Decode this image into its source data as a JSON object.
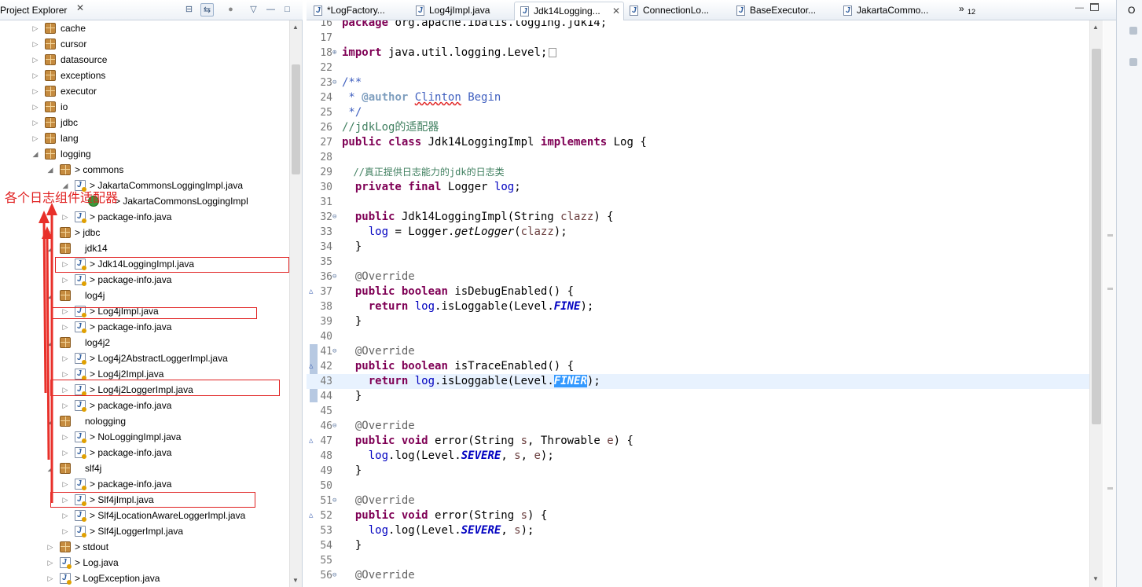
{
  "explorer": {
    "title": "Project Explorer",
    "close": "✕",
    "buttons": {
      "collapse": "⊟",
      "link": "⇆",
      "focus": "●",
      "menu": "▽",
      "minimize": "—",
      "maximize": "□"
    },
    "tree": [
      {
        "label": "cache",
        "kind": "pkg",
        "twisty": "▷"
      },
      {
        "label": "cursor",
        "kind": "pkg",
        "twisty": "▷"
      },
      {
        "label": "datasource",
        "kind": "pkg",
        "twisty": "▷"
      },
      {
        "label": "exceptions",
        "kind": "pkg",
        "twisty": "▷"
      },
      {
        "label": "executor",
        "kind": "pkg",
        "twisty": "▷"
      },
      {
        "label": "io",
        "kind": "pkg",
        "twisty": "▷"
      },
      {
        "label": "jdbc",
        "kind": "pkg",
        "twisty": "▷"
      },
      {
        "label": "lang",
        "kind": "pkg",
        "twisty": "▷"
      },
      {
        "label": "logging",
        "kind": "pkg",
        "twisty": "◢"
      },
      {
        "label": "commons",
        "kind": "pkg",
        "twisty": "◢"
      },
      {
        "label": "JakartaCommonsLoggingImpl.java",
        "kind": "java",
        "twisty": "◢"
      },
      {
        "label": "JakartaCommonsLoggingImpl",
        "kind": "class",
        "twisty": ""
      },
      {
        "label": "package-info.java",
        "kind": "java",
        "twisty": "▷"
      },
      {
        "label": "jdbc",
        "kind": "pkg",
        "twisty": "▷"
      },
      {
        "label": "jdk14",
        "kind": "pkg",
        "twisty": "◢"
      },
      {
        "label": "Jdk14LoggingImpl.java",
        "kind": "java",
        "twisty": "▷"
      },
      {
        "label": "package-info.java",
        "kind": "java",
        "twisty": "▷"
      },
      {
        "label": "log4j",
        "kind": "pkg",
        "twisty": "◢"
      },
      {
        "label": "Log4jImpl.java",
        "kind": "java",
        "twisty": "▷"
      },
      {
        "label": "package-info.java",
        "kind": "java",
        "twisty": "▷"
      },
      {
        "label": "log4j2",
        "kind": "pkg",
        "twisty": "◢"
      },
      {
        "label": "Log4j2AbstractLoggerImpl.java",
        "kind": "java",
        "twisty": "▷"
      },
      {
        "label": "Log4j2Impl.java",
        "kind": "java",
        "twisty": "▷"
      },
      {
        "label": "Log4j2LoggerImpl.java",
        "kind": "java",
        "twisty": "▷"
      },
      {
        "label": "package-info.java",
        "kind": "java",
        "twisty": "▷"
      },
      {
        "label": "nologging",
        "kind": "pkg",
        "twisty": "◢"
      },
      {
        "label": "NoLoggingImpl.java",
        "kind": "java",
        "twisty": "▷"
      },
      {
        "label": "package-info.java",
        "kind": "java",
        "twisty": "▷"
      },
      {
        "label": "slf4j",
        "kind": "pkg",
        "twisty": "◢"
      },
      {
        "label": "package-info.java",
        "kind": "java",
        "twisty": "▷"
      },
      {
        "label": "Slf4jImpl.java",
        "kind": "java",
        "twisty": "▷"
      },
      {
        "label": "Slf4jLocationAwareLoggerImpl.java",
        "kind": "java",
        "twisty": "▷"
      },
      {
        "label": "Slf4jLoggerImpl.java",
        "kind": "java",
        "twisty": "▷"
      },
      {
        "label": "stdout",
        "kind": "pkg",
        "twisty": "▷"
      },
      {
        "label": "Log.java",
        "kind": "java",
        "twisty": "▷"
      },
      {
        "label": "LogException.java",
        "kind": "java",
        "twisty": "▷"
      }
    ],
    "annotation": "各个日志组件适配器"
  },
  "editor": {
    "tabs": [
      {
        "label": "*LogFactory...",
        "active": false
      },
      {
        "label": "Log4jImpl.java",
        "active": false
      },
      {
        "label": "Jdk14Logging...",
        "active": true,
        "close": "✕"
      },
      {
        "label": "ConnectionLo...",
        "active": false
      },
      {
        "label": "BaseExecutor...",
        "active": false
      },
      {
        "label": "JakartaCommo...",
        "active": false
      }
    ],
    "overflow": "»",
    "overflow_count": "12",
    "lines": {
      "l16": {
        "n": "16",
        "text": "package org.apache.ibatis.logging.jdk14;"
      },
      "l17": {
        "n": "17"
      },
      "l18": {
        "n": "18",
        "kw": "import",
        "text": " java.util.logging.Level;"
      },
      "l22": {
        "n": "22"
      },
      "l23": {
        "n": "23",
        "text": "/**"
      },
      "l24": {
        "n": "24",
        "prefix": " * ",
        "tag": "@author",
        "author1": "Clinton",
        "author2": " Begin"
      },
      "l25": {
        "n": "25",
        "text": " */"
      },
      "l26": {
        "n": "26",
        "text": "//jdkLog的适配器"
      },
      "l27": {
        "n": "27",
        "k1": "public",
        "k2": "class",
        "mid": " Jdk14LoggingImpl ",
        "k3": "implements",
        "tail": " Log {"
      },
      "l28": {
        "n": "28"
      },
      "l29": {
        "n": "29",
        "text": "  //真正提供日志能力的jdk的日志类"
      },
      "l30": {
        "n": "30",
        "k1": "private",
        "k2": "final",
        "mid": " Logger ",
        "fld": "log",
        "tail": ";"
      },
      "l31": {
        "n": "31"
      },
      "l32": {
        "n": "32",
        "k1": "public",
        "mid": " Jdk14LoggingImpl(String ",
        "param": "clazz",
        "tail": ") {"
      },
      "l33": {
        "n": "33",
        "fld": "log",
        "mid": " = Logger.",
        "mtd": "getLogger",
        "open": "(",
        "param": "clazz",
        "tail": ");"
      },
      "l34": {
        "n": "34",
        "text": "  }"
      },
      "l35": {
        "n": "35"
      },
      "l36": {
        "n": "36",
        "an": "@Override"
      },
      "l37": {
        "n": "37",
        "k1": "public",
        "k2": "boolean",
        "tail": " isDebugEnabled() {"
      },
      "l38": {
        "n": "38",
        "k1": "return",
        "fld": "log",
        "mid": ".isLoggable(Level.",
        "sfld": "FINE",
        "tail": ");"
      },
      "l39": {
        "n": "39",
        "text": "  }"
      },
      "l40": {
        "n": "40"
      },
      "l41": {
        "n": "41",
        "an": "@Override"
      },
      "l42": {
        "n": "42",
        "k1": "public",
        "k2": "boolean",
        "tail": " isTraceEnabled() {"
      },
      "l43": {
        "n": "43",
        "k1": "return",
        "fld": "log",
        "mid": ".isLoggable(Level.",
        "sfld": "FINER",
        "tail": ");"
      },
      "l44": {
        "n": "44",
        "text": "  }"
      },
      "l45": {
        "n": "45"
      },
      "l46": {
        "n": "46",
        "an": "@Override"
      },
      "l47": {
        "n": "47",
        "k1": "public",
        "k2": "void",
        "mid": " error(String ",
        "param1": "s",
        "mid2": ", Throwable ",
        "param2": "e",
        "tail": ") {"
      },
      "l48": {
        "n": "48",
        "fld": "log",
        "mid": ".log(Level.",
        "sfld": "SEVERE",
        "c1": ", ",
        "param1": "s",
        "c2": ", ",
        "param2": "e",
        "tail": ");"
      },
      "l49": {
        "n": "49",
        "text": "  }"
      },
      "l50": {
        "n": "50"
      },
      "l51": {
        "n": "51",
        "an": "@Override"
      },
      "l52": {
        "n": "52",
        "k1": "public",
        "k2": "void",
        "mid": " error(String ",
        "param1": "s",
        "tail": ") {"
      },
      "l53": {
        "n": "53",
        "fld": "log",
        "mid": ".log(Level.",
        "sfld": "SEVERE",
        "c1": ", ",
        "param1": "s",
        "tail": ");"
      },
      "l54": {
        "n": "54",
        "text": "  }"
      },
      "l55": {
        "n": "55"
      },
      "l56": {
        "n": "56",
        "an": "@Override"
      }
    }
  },
  "right_strip": {
    "label": "O"
  },
  "colors": {
    "keyword": "#7f0055",
    "comment": "#3f7f5f",
    "javadoc": "#3f5fbf",
    "field": "#0000c0",
    "annotation_red": "#e02020",
    "current_line": "#e8f2fe"
  }
}
